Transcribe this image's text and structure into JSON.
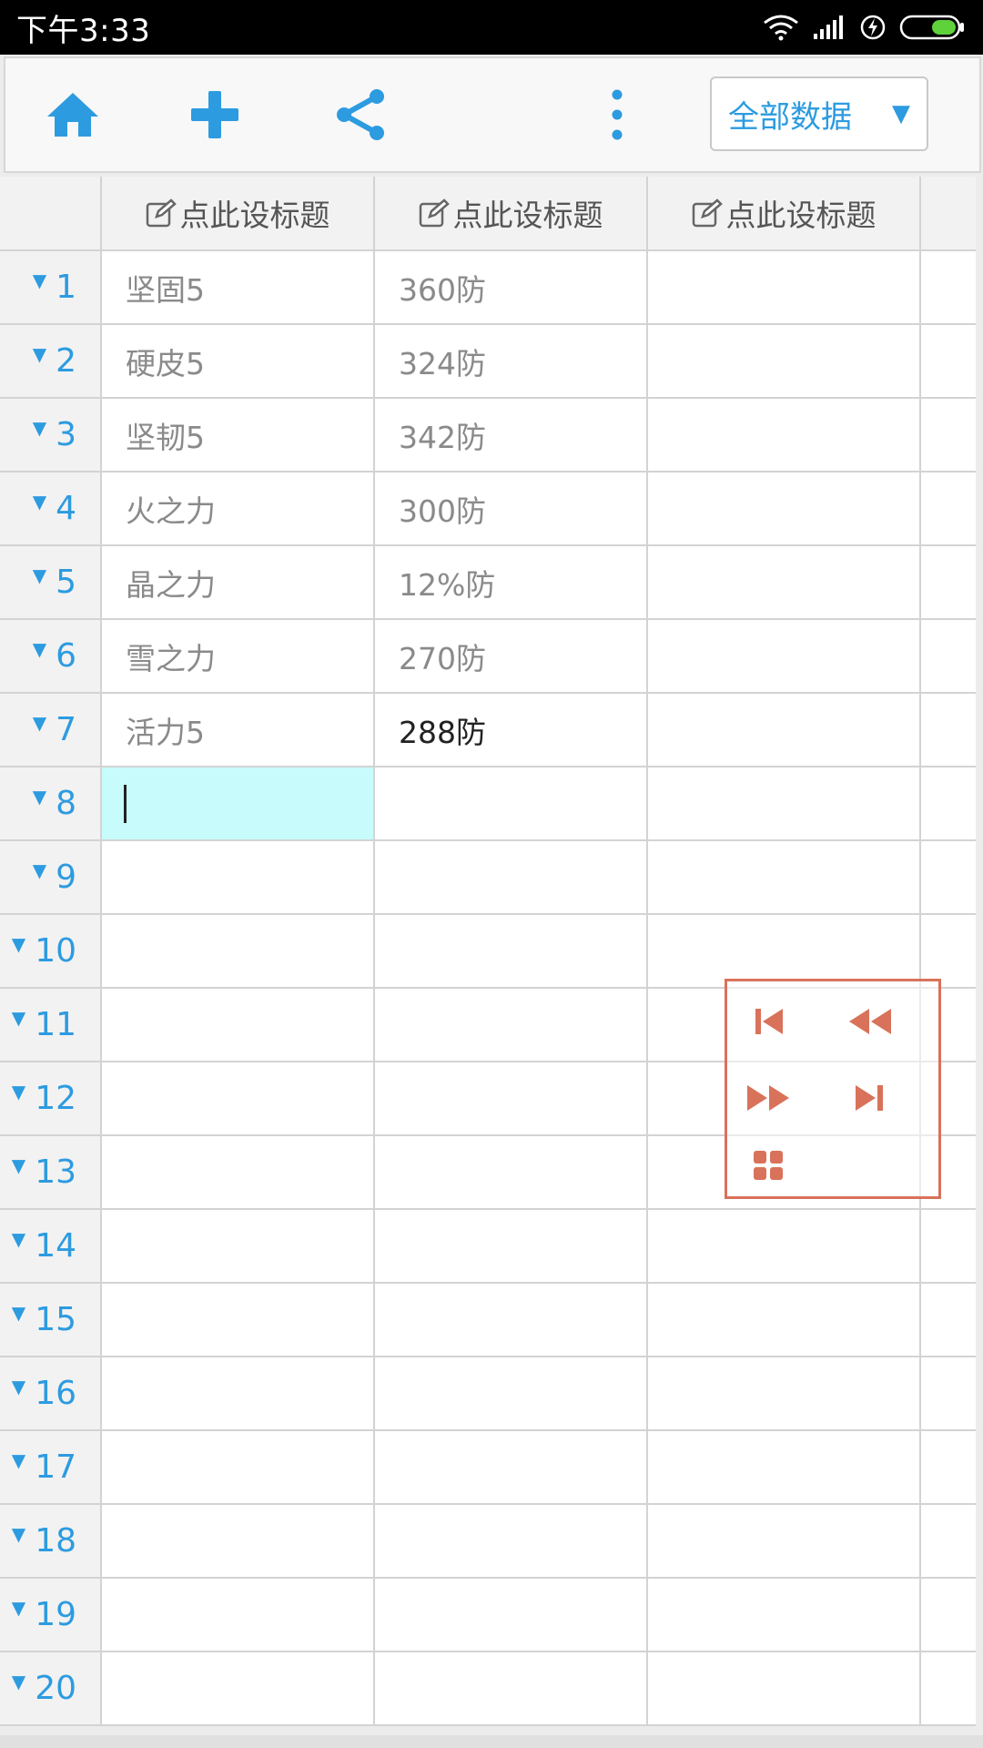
{
  "status_bar": {
    "time": "下午3:33"
  },
  "toolbar": {
    "home_icon": "home-icon",
    "add_icon": "plus-icon",
    "share_icon": "share-icon",
    "more_icon": "more-vertical-icon",
    "dropdown_label": "全部数据",
    "dropdown_arrow": "▼"
  },
  "columns": [
    "点此设标题",
    "点此设标题",
    "点此设标题"
  ],
  "rows": [
    {
      "num": "1",
      "cells": [
        "坚固5",
        "360防",
        ""
      ]
    },
    {
      "num": "2",
      "cells": [
        "硬皮5",
        "324防",
        ""
      ]
    },
    {
      "num": "3",
      "cells": [
        "坚韧5",
        "342防",
        ""
      ]
    },
    {
      "num": "4",
      "cells": [
        "火之力",
        "300防",
        ""
      ]
    },
    {
      "num": "5",
      "cells": [
        "晶之力",
        "12%防",
        ""
      ]
    },
    {
      "num": "6",
      "cells": [
        "雪之力",
        "270防",
        ""
      ]
    },
    {
      "num": "7",
      "cells": [
        "活力5",
        "288防",
        ""
      ]
    },
    {
      "num": "8",
      "cells": [
        "",
        "",
        ""
      ]
    },
    {
      "num": "9",
      "cells": [
        "",
        "",
        ""
      ]
    },
    {
      "num": "10",
      "cells": [
        "",
        "",
        ""
      ]
    },
    {
      "num": "11",
      "cells": [
        "",
        "",
        ""
      ]
    },
    {
      "num": "12",
      "cells": [
        "",
        "",
        ""
      ]
    },
    {
      "num": "13",
      "cells": [
        "",
        "",
        ""
      ]
    },
    {
      "num": "14",
      "cells": [
        "",
        "",
        ""
      ]
    },
    {
      "num": "15",
      "cells": [
        "",
        "",
        ""
      ]
    },
    {
      "num": "16",
      "cells": [
        "",
        "",
        ""
      ]
    },
    {
      "num": "17",
      "cells": [
        "",
        "",
        ""
      ]
    },
    {
      "num": "18",
      "cells": [
        "",
        "",
        ""
      ]
    },
    {
      "num": "19",
      "cells": [
        "",
        "",
        ""
      ]
    },
    {
      "num": "20",
      "cells": [
        "",
        "",
        ""
      ]
    }
  ],
  "active_cell": {
    "row": "8",
    "col": "1"
  },
  "nav_panel": {
    "buttons": [
      "first-icon",
      "previous-page-icon",
      "next-page-icon",
      "last-icon",
      "grid-icon"
    ],
    "color": "#d9725a"
  },
  "colors": {
    "accent": "#2d9be0",
    "active_cell": "#c8fbfb"
  }
}
